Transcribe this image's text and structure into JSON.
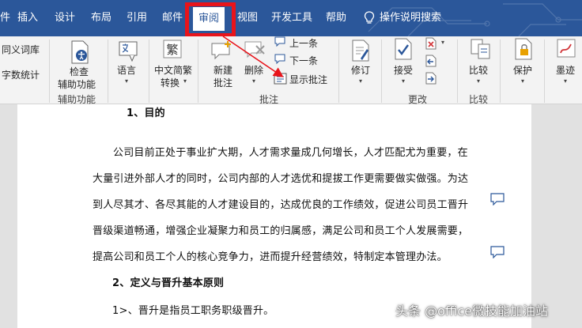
{
  "tabs": {
    "file_partial": "件",
    "insert": "插入",
    "design": "设计",
    "layout": "布局",
    "references": "引用",
    "mailings": "邮件",
    "review": "审阅",
    "view": "视图",
    "developer": "开发工具",
    "help": "帮助",
    "search": "操作说明搜索"
  },
  "ribbon": {
    "thesaurus": "同义词库",
    "word_count": "字数统计",
    "check_line1": "检查",
    "check_line2": "辅助功能",
    "group_accessibility": "辅助功能",
    "language": "语言",
    "chinese_line1": "中文简繁",
    "chinese_line2": "转换",
    "new_comment_line1": "新建",
    "new_comment_line2": "批注",
    "delete": "删除",
    "previous": "上一条",
    "next": "下一条",
    "show_comments": "显示批注",
    "group_comments": "批注",
    "track_changes": "修订",
    "accept": "接受",
    "group_changes": "更改",
    "compare": "比较",
    "group_compare": "比较",
    "protect": "保护",
    "ink": "墨迹"
  },
  "document": {
    "heading1": "1、目的",
    "para_lines": [
      "公司目前正处于事业扩大期，人才需求量成几何增长，人才匹配尤为重要，在",
      "大量引进外部人才的同时，公司内部的人才选优和提拔工作更需要做实做强。为达",
      "到人尽其才、各尽其能的人才建设目的，达成优良的工作绩效，促进公司员工晋升",
      "晋级渠道畅通，增强企业凝聚力和员工的归属感，满足公司和员工个人发展需要，",
      "提高公司和员工个人的核心竞争力，进而提升经营绩效，特制定本管理办法。"
    ],
    "heading2": "2、定义与晋升基本原则",
    "item1": "1>、晋升是指员工职务职级晋升。"
  },
  "watermark": "头条 @office微技能加油站",
  "colors": {
    "accent": "#2b579a",
    "highlight_red": "#e8141b",
    "ribbon_bg": "#f3f3f3"
  }
}
